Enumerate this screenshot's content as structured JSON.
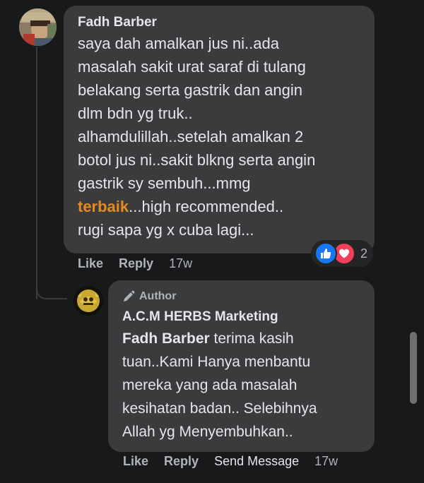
{
  "comment": {
    "author": "Fadh Barber",
    "text_before": "saya dah amalkan jus ni..ada\nmasalah sakit urat saraf di tulang\nbelakang serta gastrik dan angin\ndlm bdn yg truk..\nalhamdulillah..setelah amalkan 2\nbotol jus ni..sakit blkng serta angin\ngastrik sy sembuh...mmg\n",
    "highlight": "terbaik",
    "text_after": "...high recommended..\nrugi sapa yg x cuba lagi...",
    "like_label": "Like",
    "reply_label": "Reply",
    "time": "17w",
    "reaction_count": "2",
    "reaction_icons": [
      "like-icon",
      "love-icon"
    ]
  },
  "reply": {
    "badge": "Author",
    "badge_icon": "pencil-icon",
    "page_name": "A.C.M HERBS Marketing",
    "mention": "Fadh Barber",
    "text": " terima kasih\ntuan..Kami Hanya menbantu\nmereka yang ada masalah\nkesihatan badan.. Selebihnya\nAllah yg Menyembuhkan..",
    "like_label": "Like",
    "reply_label": "Reply",
    "send_label": "Send Message",
    "time": "17w"
  },
  "colors": {
    "background": "#18191a",
    "bubble": "#3a3b3c",
    "highlight": "#e58a1f",
    "like": "#1877f2",
    "love": "#f33e58"
  }
}
